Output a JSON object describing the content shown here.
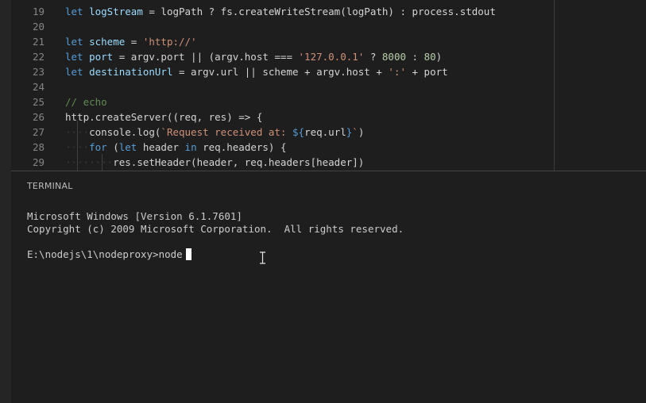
{
  "editor": {
    "lines": [
      {
        "num": "19",
        "segments": [
          {
            "cls": "kw",
            "t": "let "
          },
          {
            "cls": "var",
            "t": "logStream"
          },
          {
            "cls": "fn",
            "t": " = logPath ? fs.createWriteStream(logPath) : process.stdout"
          }
        ]
      },
      {
        "num": "20",
        "segments": []
      },
      {
        "num": "21",
        "segments": [
          {
            "cls": "kw",
            "t": "let "
          },
          {
            "cls": "var",
            "t": "scheme"
          },
          {
            "cls": "fn",
            "t": " = "
          },
          {
            "cls": "str",
            "t": "'http://'"
          }
        ]
      },
      {
        "num": "22",
        "segments": [
          {
            "cls": "kw",
            "t": "let "
          },
          {
            "cls": "var",
            "t": "port"
          },
          {
            "cls": "fn",
            "t": " = argv.port || (argv.host === "
          },
          {
            "cls": "str",
            "t": "'127.0.0.1'"
          },
          {
            "cls": "fn",
            "t": " ? "
          },
          {
            "cls": "num",
            "t": "8000"
          },
          {
            "cls": "fn",
            "t": " : "
          },
          {
            "cls": "num",
            "t": "80"
          },
          {
            "cls": "fn",
            "t": ")"
          }
        ]
      },
      {
        "num": "23",
        "segments": [
          {
            "cls": "kw",
            "t": "let "
          },
          {
            "cls": "var",
            "t": "destinationUrl"
          },
          {
            "cls": "fn",
            "t": " = argv.url || scheme + argv.host + "
          },
          {
            "cls": "str",
            "t": "':'"
          },
          {
            "cls": "fn",
            "t": " + port"
          }
        ]
      },
      {
        "num": "24",
        "segments": []
      },
      {
        "num": "25",
        "segments": [
          {
            "cls": "cmt",
            "t": "// echo"
          }
        ]
      },
      {
        "num": "26",
        "segments": [
          {
            "cls": "fn",
            "t": "http.createServer((req, res) => {"
          }
        ]
      },
      {
        "num": "27",
        "segments": [
          {
            "cls": "ws",
            "t": "····"
          },
          {
            "cls": "fn",
            "t": "console.log("
          },
          {
            "cls": "str",
            "t": "`Request received at: "
          },
          {
            "cls": "kw",
            "t": "${"
          },
          {
            "cls": "fn",
            "t": "req.url"
          },
          {
            "cls": "kw",
            "t": "}"
          },
          {
            "cls": "str",
            "t": "`"
          },
          {
            "cls": "fn",
            "t": ")"
          }
        ]
      },
      {
        "num": "28",
        "segments": [
          {
            "cls": "ws",
            "t": "····"
          },
          {
            "cls": "kw",
            "t": "for"
          },
          {
            "cls": "fn",
            "t": " ("
          },
          {
            "cls": "kw",
            "t": "let"
          },
          {
            "cls": "fn",
            "t": " header "
          },
          {
            "cls": "kw",
            "t": "in"
          },
          {
            "cls": "fn",
            "t": " req.headers) {"
          }
        ]
      },
      {
        "num": "29",
        "segments": [
          {
            "cls": "ws",
            "t": "········"
          },
          {
            "cls": "fn",
            "t": "res.setHeader(header, req.headers[header])"
          }
        ]
      }
    ]
  },
  "terminal": {
    "title": "TERMINAL",
    "line1": "Microsoft Windows [Version 6.1.7601]",
    "line2": "Copyright (c) 2009 Microsoft Corporation.  All rights reserved.",
    "prompt": "E:\\nodejs\\1\\nodeproxy>",
    "input": "node"
  },
  "colors": {
    "background": "#1e1e1e",
    "keyword": "#569cd6",
    "variable": "#9cdcfe",
    "string": "#ce9178",
    "number": "#b5cea8",
    "comment": "#608b4e"
  }
}
